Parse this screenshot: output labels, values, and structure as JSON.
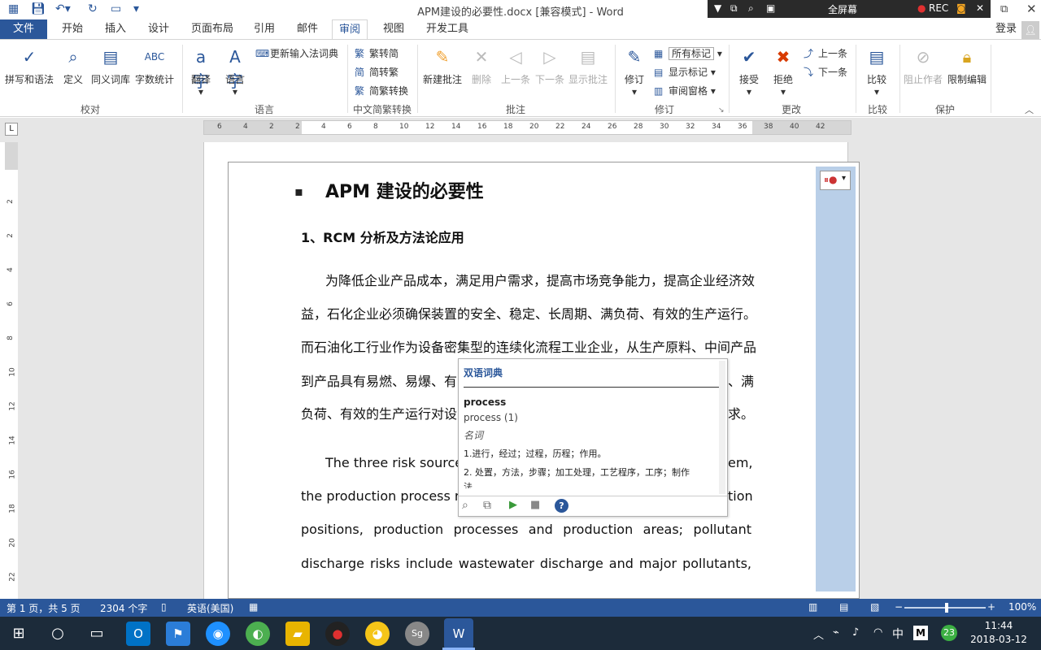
{
  "titlebar": {
    "title": "APM建设的必要性.docx [兼容模式] - Word",
    "recorder": {
      "fullscreen": "全屏幕",
      "rec": "REC"
    }
  },
  "menu": {
    "file": "文件",
    "tabs": [
      "开始",
      "插入",
      "设计",
      "页面布局",
      "引用",
      "邮件",
      "审阅",
      "视图",
      "开发工具"
    ],
    "active": "审阅",
    "login": "登录"
  },
  "ribbon": {
    "proofing": {
      "label": "校对",
      "buttons": [
        "拼写和语法",
        "定义",
        "同义词库",
        "字数统计"
      ]
    },
    "language": {
      "label": "语言",
      "buttons": [
        "翻译",
        "语言"
      ],
      "update_ime": "更新输入法词典"
    },
    "chinese": {
      "label": "中文简繁转换",
      "items": [
        "繁转简",
        "简转繁",
        "简繁转换"
      ]
    },
    "comments": {
      "label": "批注",
      "buttons": [
        "新建批注",
        "删除",
        "上一条",
        "下一条",
        "显示批注"
      ]
    },
    "tracking": {
      "label": "修订",
      "track": "修订",
      "markup_select": "所有标记",
      "show_markup": "显示标记",
      "review_pane": "审阅窗格"
    },
    "changes": {
      "label": "更改",
      "accept": "接受",
      "reject": "拒绝",
      "prev": "上一条",
      "next": "下一条"
    },
    "compare": {
      "label": "比较",
      "button": "比较"
    },
    "protect": {
      "label": "保护",
      "buttons": [
        "阻止作者",
        "限制编辑"
      ]
    }
  },
  "ruler": {
    "h_ticks": [
      "6",
      "4",
      "2",
      "2",
      "4",
      "6",
      "8",
      "10",
      "12",
      "14",
      "16",
      "18",
      "20",
      "22",
      "24",
      "26",
      "28",
      "30",
      "32",
      "34",
      "36",
      "38",
      "40",
      "42"
    ],
    "v_ticks": [
      "2",
      "2",
      "4",
      "6",
      "8",
      "10",
      "12",
      "14",
      "16",
      "18",
      "20",
      "22",
      "24"
    ]
  },
  "document": {
    "heading": "APM 建设的必要性",
    "subheading": "1、RCM 分析及方法论应用",
    "para1": [
      "为降低企业产品成本，满足用户需求，提高市场竞争能力，提高企业经济效",
      "益，石化企业必须确保装置的安全、稳定、长周期、满负荷、有效的生产运行。",
      "而石油化工行业作为设备密集型的连续化流程工业企业，从生产原料、中间产品",
      "到产品具有易燃、易爆、有",
      "、满",
      "负荷、有效的生产运行对设",
      "求。"
    ],
    "para2": [
      "The three risk source",
      "em,",
      "the production process r",
      "tion",
      "positions, production processes and production areas; pollutant",
      "discharge risks include wastewater discharge and major pollutants,"
    ]
  },
  "popup": {
    "title": "双语词典",
    "word": "process",
    "entry": "process (1)",
    "pos": "名词",
    "def1": "1.进行，经过；过程，历程；作用。",
    "def2": "2. 处置，方法，步骤；加工处理，工艺程序，工序；制作",
    "def2_cont": "法"
  },
  "status": {
    "page": "第 1 页，共 5 页",
    "words": "2304 个字",
    "lang": "英语(美国)",
    "zoom": "100%"
  },
  "taskbar": {
    "time": "11:44",
    "date": "2018-03-12",
    "ime": "中",
    "badge": "23"
  }
}
